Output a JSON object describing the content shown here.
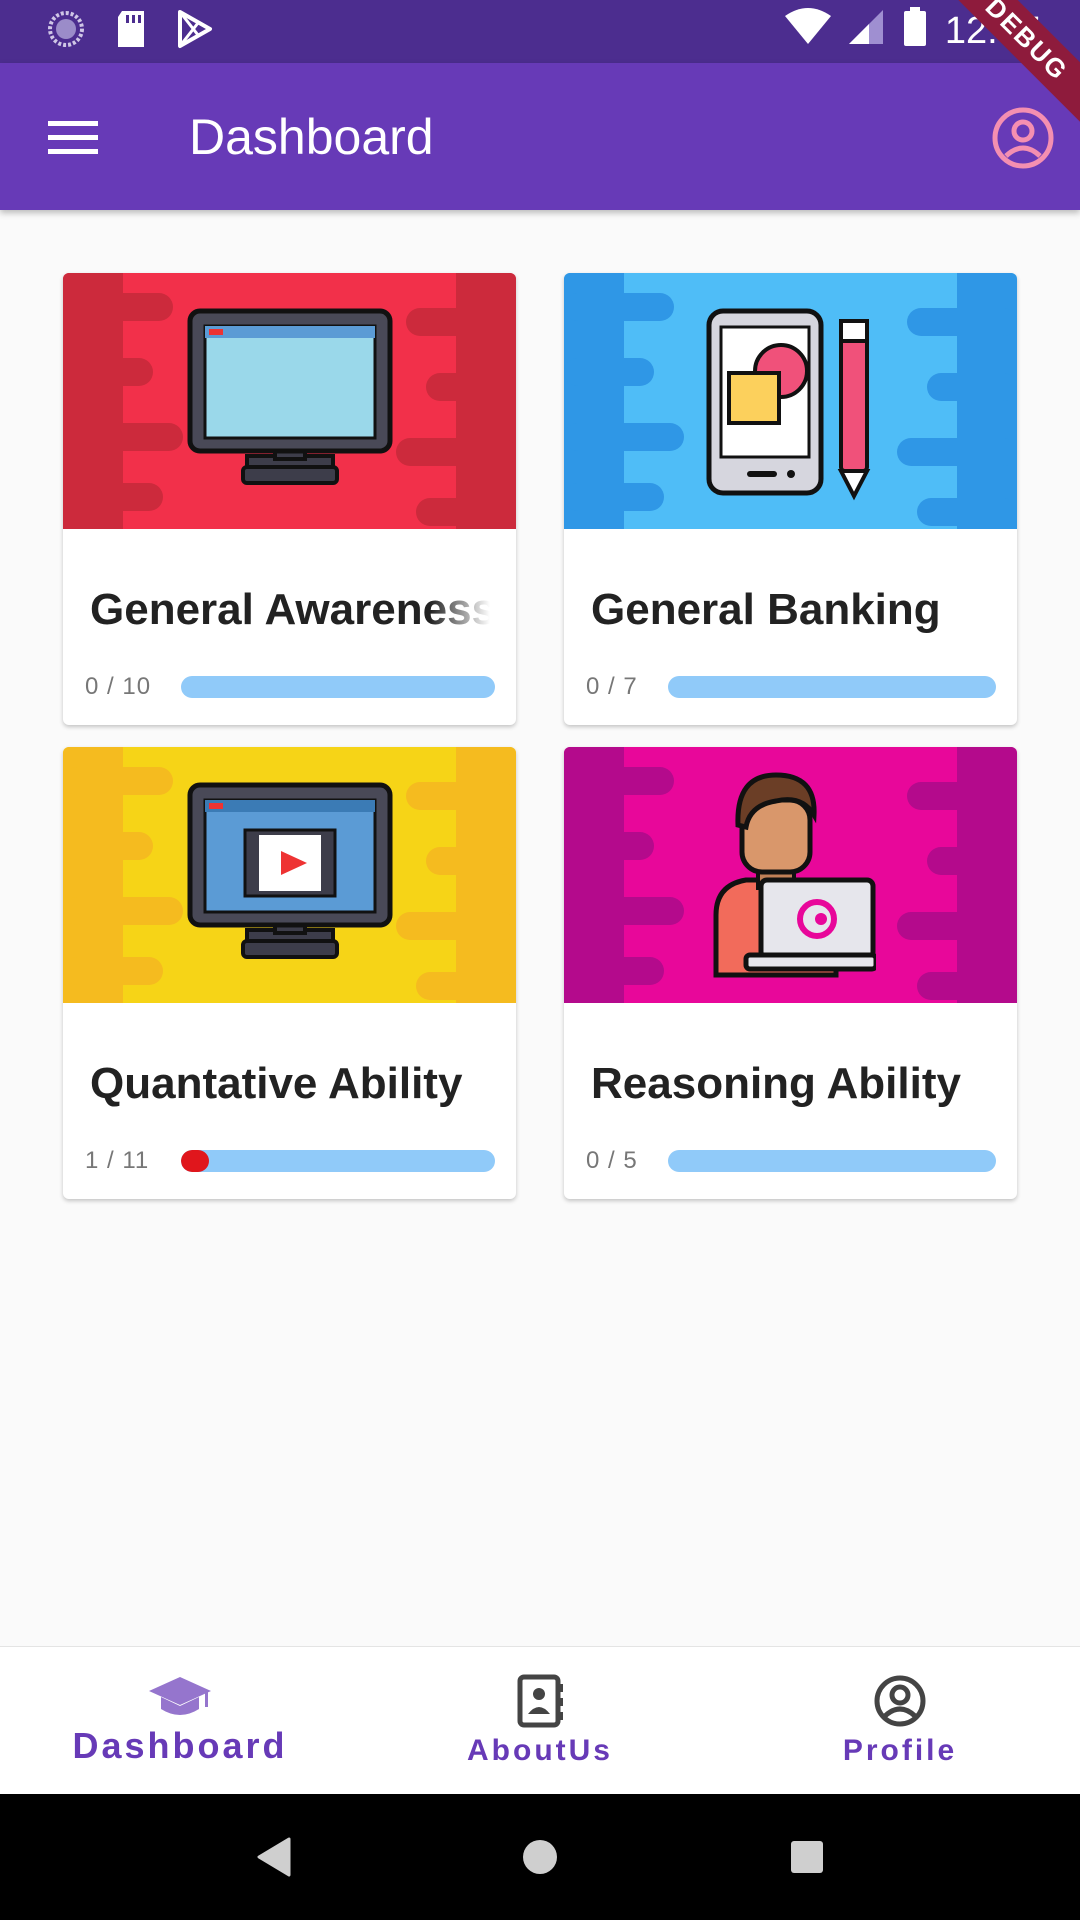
{
  "status_bar": {
    "time": "12:37",
    "debug_label": "DEBUG"
  },
  "app_bar": {
    "title": "Dashboard"
  },
  "cards": [
    {
      "title": "General Awareness",
      "progress_label": "0 / 10",
      "progress": 0.0,
      "theme_color": "#f2304a",
      "illustration": "monitor-icon"
    },
    {
      "title": "General Banking",
      "progress_label": "0 / 7",
      "progress": 0.0,
      "theme_color": "#4fbdf7",
      "illustration": "phone-pen-icon"
    },
    {
      "title": "Quantative Ability",
      "progress_label": "1 / 11",
      "progress": 0.09,
      "theme_color": "#f6d417",
      "illustration": "video-monitor-icon"
    },
    {
      "title": "Reasoning Ability",
      "progress_label": "0 / 5",
      "progress": 0.0,
      "theme_color": "#e8079a",
      "illustration": "person-laptop-icon"
    }
  ],
  "bottom_nav": {
    "items": [
      {
        "label": "Dashboard",
        "icon": "graduation-cap-icon",
        "active": true
      },
      {
        "label": "AboutUs",
        "icon": "contact-book-icon",
        "active": false
      },
      {
        "label": "Profile",
        "icon": "account-circle-icon",
        "active": false
      }
    ]
  },
  "colors": {
    "primary": "#673ab7",
    "status_bar": "#4c2d8f",
    "progress_track": "#90caf9",
    "progress_fill": "#e0161c",
    "profile_icon": "#f48fb1"
  }
}
